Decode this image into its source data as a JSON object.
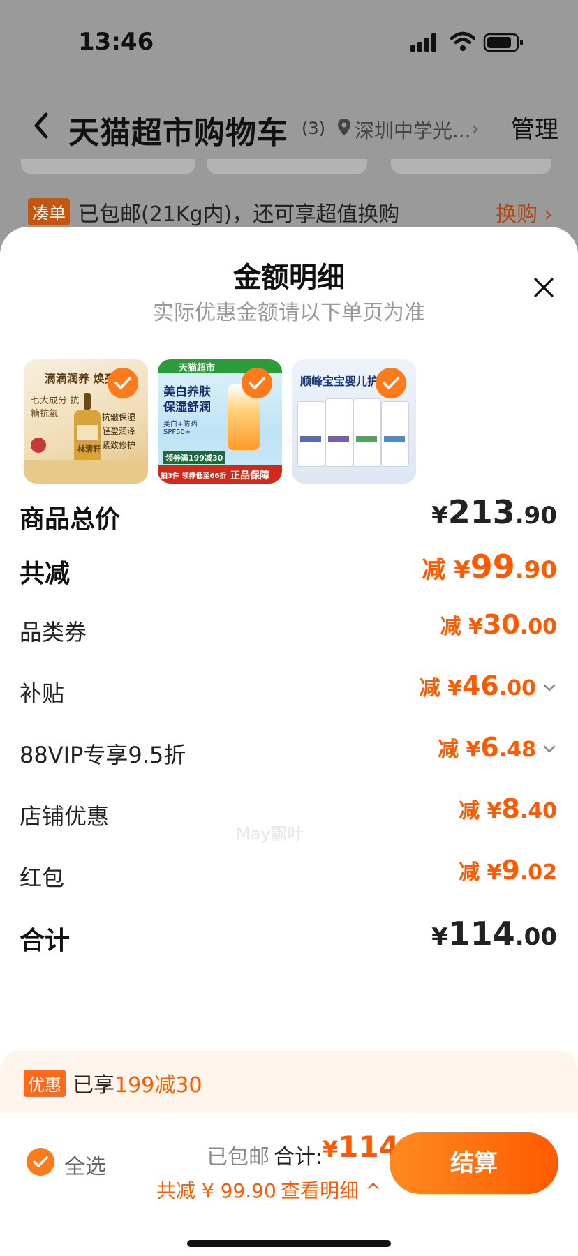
{
  "status_bar": {
    "time": "13:46"
  },
  "navbar": {
    "title": "天猫超市购物车",
    "count": "(3)",
    "location": "深圳中学光...",
    "manage": "管理"
  },
  "promo_strip": {
    "tag": "凑单",
    "text": "已包邮(21Kg内)，还可享超值换购",
    "action": "换购 ›"
  },
  "modal": {
    "title": "金额明细",
    "subtitle": "实际优惠金额请以下单页为准",
    "products": [
      {
        "label": "滴滴润养 焕亮",
        "sublabel": "七大成分 抗糖抗氧",
        "bullets": [
          "抗皱保湿",
          "轻盈润泽",
          "紧致修护"
        ],
        "brand": "林清轩"
      },
      {
        "label": "天猫超市",
        "sublabel": "美白养肤 保湿舒润",
        "extra": "美白+防晒 SPF50+",
        "banner": "正品保障",
        "coupon": "领券满199减30",
        "note": "拍3件 领券低至66折"
      },
      {
        "label": "顺峰宝宝婴儿护肤"
      }
    ],
    "rows": [
      {
        "label": "商品总价",
        "prefix": "¥",
        "int": "213",
        "dec": ".90",
        "style": "total"
      },
      {
        "label": "共减",
        "prefix": "减 ¥",
        "int": "99",
        "dec": ".90",
        "style": "discount-total"
      },
      {
        "label": "品类券",
        "prefix": "减 ¥",
        "int": "30",
        "dec": ".00"
      },
      {
        "label": "补贴",
        "prefix": "减 ¥",
        "int": "46",
        "dec": ".00",
        "expandable": true
      },
      {
        "label": "88VIP专享9.5折",
        "prefix": "减 ¥",
        "int": "6",
        "dec": ".48",
        "expandable": true
      },
      {
        "label": "店铺优惠",
        "prefix": "减 ¥",
        "int": "8",
        "dec": ".40"
      },
      {
        "label": "红包",
        "prefix": "减 ¥",
        "int": "9",
        "dec": ".02"
      },
      {
        "label": "合计",
        "prefix": "¥",
        "int": "114",
        "dec": ".00",
        "style": "total"
      }
    ],
    "watermark": "May飘叶"
  },
  "discount_band": {
    "tag": "优惠",
    "text1": "已享",
    "text2": "199减30"
  },
  "bottom_bar": {
    "select_all": "全选",
    "free_shipping": "已包邮",
    "total_label": "合计:",
    "total_prefix": "¥",
    "total_value": "114",
    "saved": "共减 ¥ 99.90",
    "view_detail": "查看明细 ^",
    "checkout": "结算"
  },
  "colors": {
    "accent": "#ff5a00",
    "check": "#ff7a1a"
  }
}
